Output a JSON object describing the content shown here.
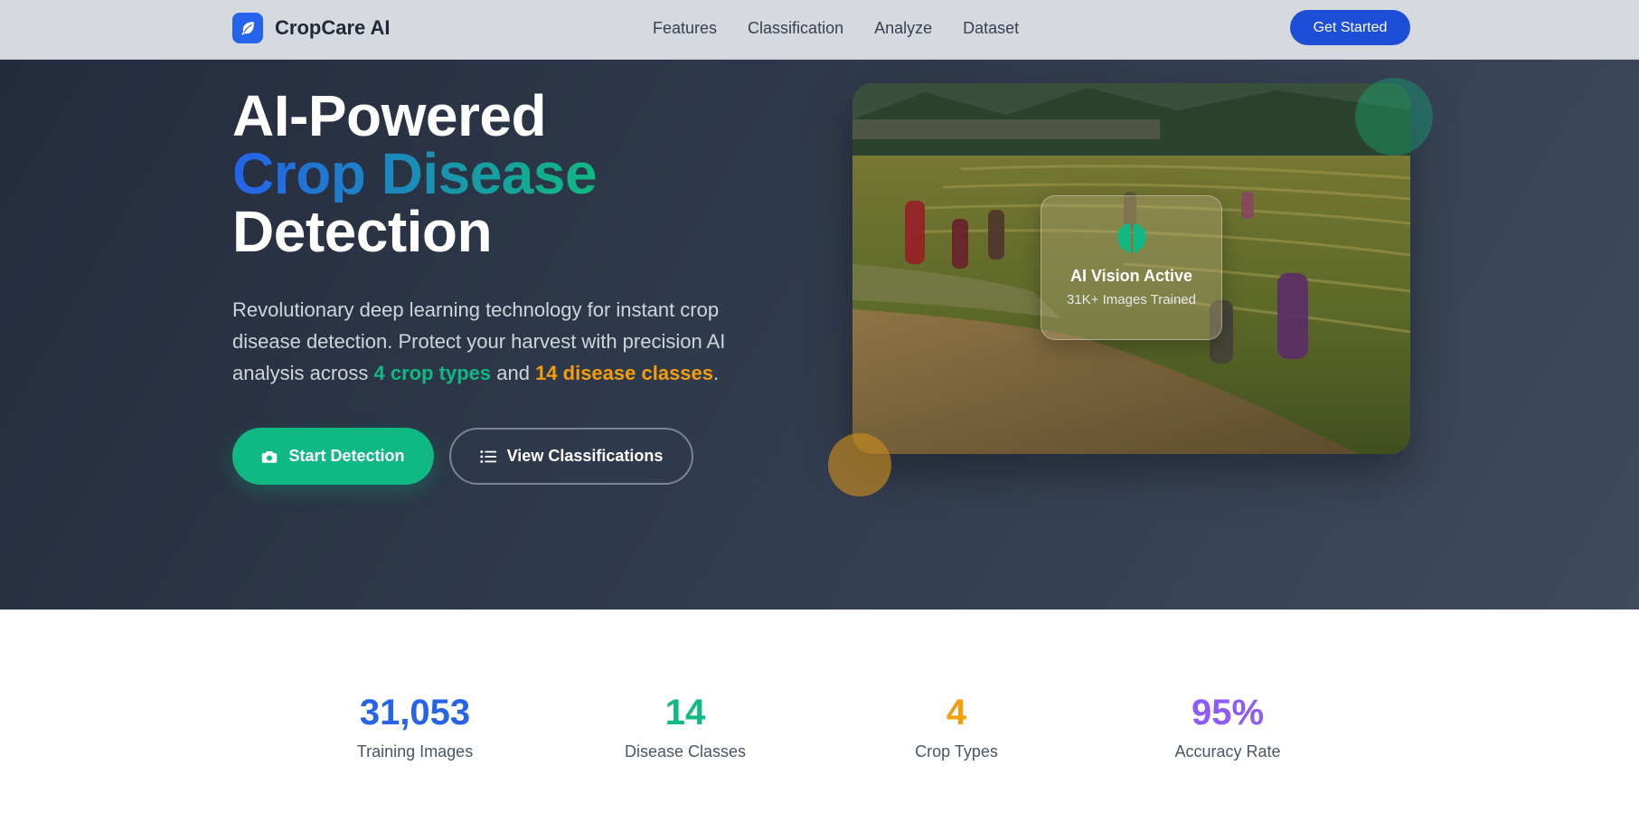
{
  "nav": {
    "brand": "CropCare AI",
    "links": [
      "Features",
      "Classification",
      "Analyze",
      "Dataset"
    ],
    "cta": "Get Started"
  },
  "hero": {
    "title_line1": "AI-Powered",
    "title_line2": "Crop Disease",
    "title_line3": "Detection",
    "desc_part1": "Revolutionary deep learning technology for instant crop disease detection. Protect your harvest with precision AI analysis across ",
    "desc_hl1": "4 crop types",
    "desc_part2": " and ",
    "desc_hl2": "14 disease classes",
    "desc_part3": ".",
    "btn_start": "Start Detection",
    "btn_view": "View Classifications",
    "card_title": "AI Vision Active",
    "card_sub": "31K+ Images Trained"
  },
  "stats": [
    {
      "value": "31,053",
      "label": "Training Images",
      "color": "#2563eb"
    },
    {
      "value": "14",
      "label": "Disease Classes",
      "color": "#10b981"
    },
    {
      "value": "4",
      "label": "Crop Types",
      "color": "#f59e0b"
    },
    {
      "value": "95%",
      "label": "Accuracy Rate",
      "color": "#8b5cf6"
    }
  ],
  "icons": {
    "brand": "leaf-icon",
    "start": "camera-icon",
    "view": "list-icon",
    "card": "brain-icon"
  },
  "colors": {
    "primary": "#2563eb",
    "accent_green": "#10b981",
    "accent_orange": "#f59e0b",
    "accent_purple": "#8b5cf6"
  }
}
